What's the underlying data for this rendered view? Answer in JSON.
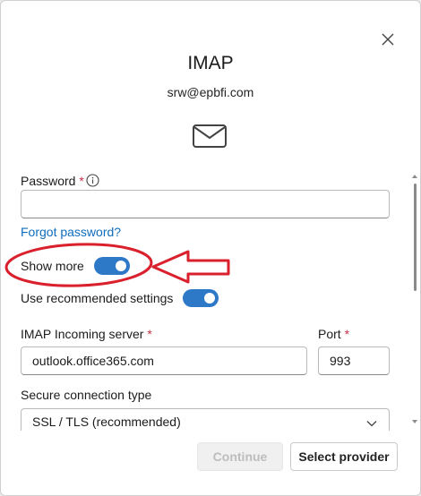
{
  "dialog": {
    "title": "IMAP",
    "email": "srw@epbfi.com"
  },
  "password": {
    "label": "Password",
    "required_mark": "*",
    "value": "",
    "placeholder": ""
  },
  "forgot_password_link": "Forgot password?",
  "show_more": {
    "label": "Show more",
    "checked": true
  },
  "recommended_settings": {
    "label": "Use recommended settings",
    "checked": true
  },
  "incoming_server": {
    "label": "IMAP Incoming server",
    "required_mark": "*",
    "value": "outlook.office365.com"
  },
  "port": {
    "label": "Port",
    "required_mark": "*",
    "value": "993"
  },
  "secure_connection": {
    "label": "Secure connection type",
    "selected": "SSL / TLS (recommended)"
  },
  "footer": {
    "continue_label": "Continue",
    "select_provider_label": "Select provider"
  },
  "colors": {
    "accent": "#2e78c8",
    "link": "#0f6cbd",
    "required": "#c4314b",
    "annotation": "#d9202c"
  },
  "icons": [
    "close-icon",
    "mail-icon",
    "info-icon",
    "chevron-down-icon"
  ]
}
